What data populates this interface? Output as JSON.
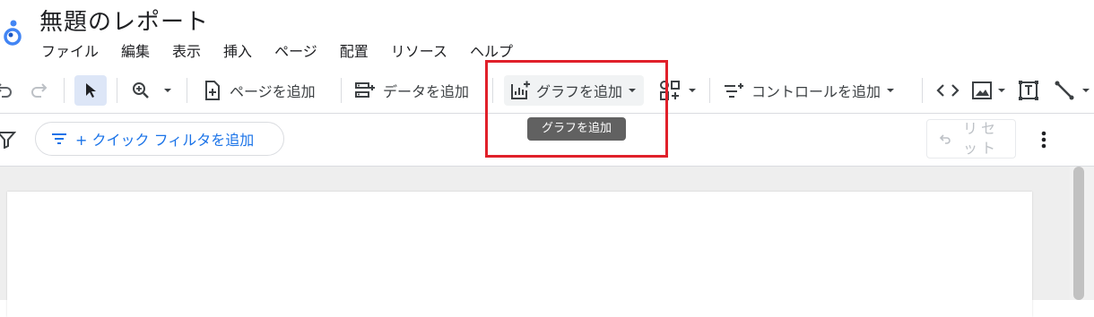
{
  "header": {
    "title": "無題のレポート",
    "menu": [
      "ファイル",
      "編集",
      "表示",
      "挿入",
      "ページ",
      "配置",
      "リソース",
      "ヘルプ"
    ]
  },
  "toolbar": {
    "add_page": "ページを追加",
    "add_data": "データを追加",
    "add_chart": "グラフを追加",
    "add_control": "コントロールを追加"
  },
  "tooltip": "グラフを追加",
  "filterbar": {
    "quick_filter": "+ クイック フィルタを追加",
    "reset": "リセット"
  },
  "colors": {
    "highlight": "#e0202a",
    "accent": "#1a73e8",
    "tooltip_bg": "#616161"
  }
}
